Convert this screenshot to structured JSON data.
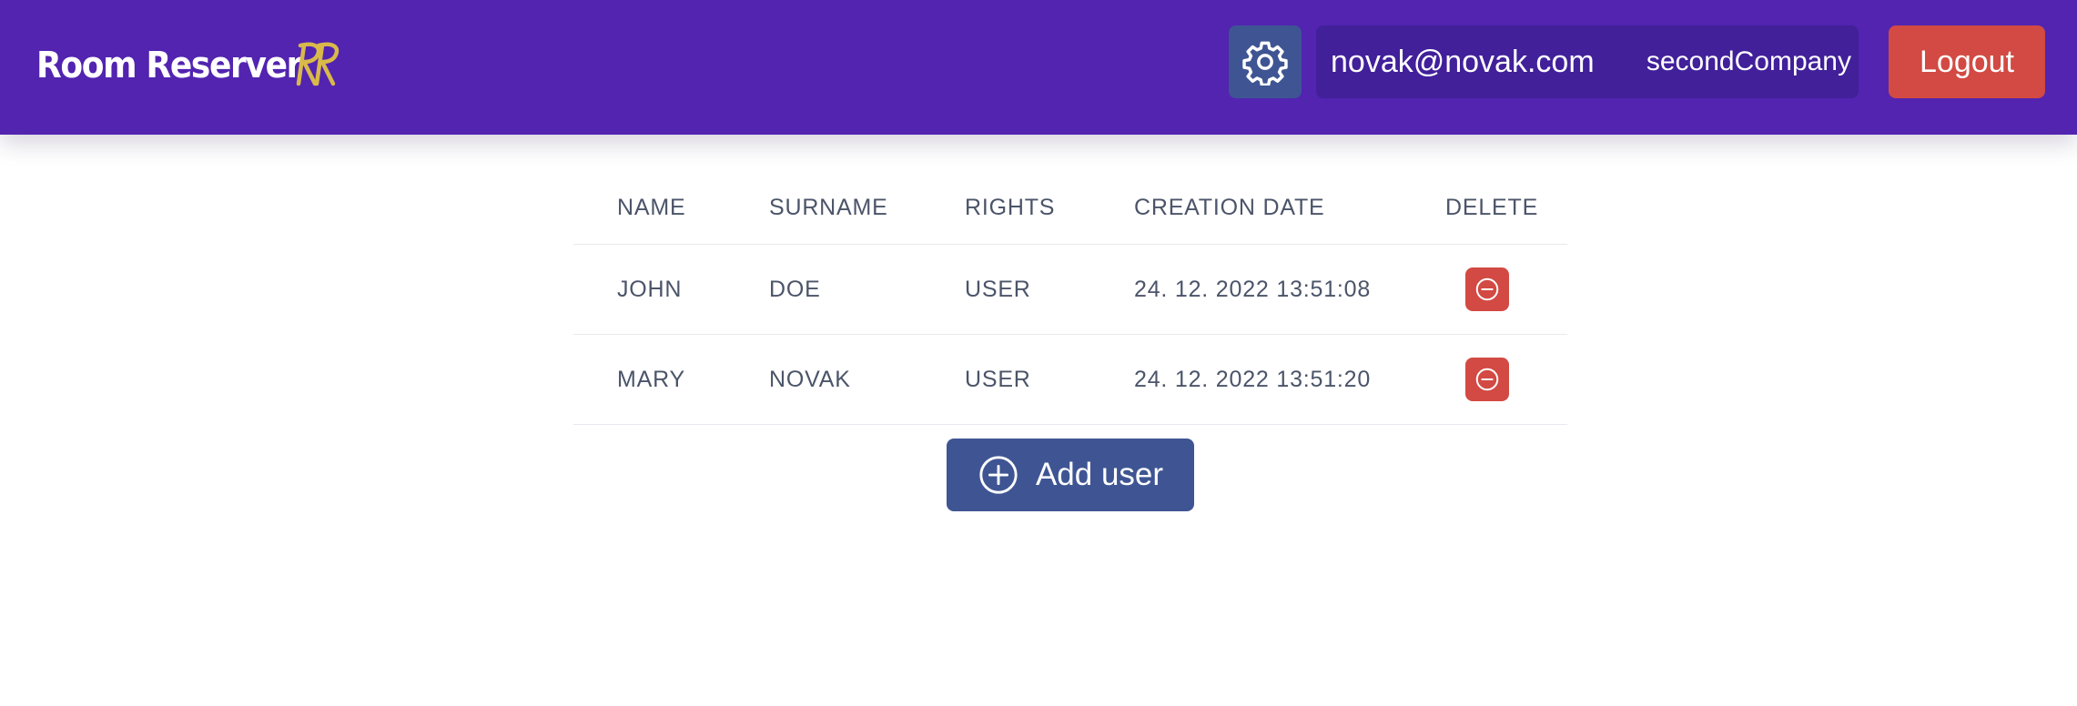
{
  "header": {
    "brand_name": "Room Reserver",
    "settings_icon": "gear-icon",
    "user_email": "novak@novak.com",
    "company": "secondCompany",
    "logout_label": "Logout"
  },
  "table": {
    "columns": [
      "NAME",
      "SURNAME",
      "RIGHTS",
      "CREATION DATE",
      "DELETE"
    ],
    "rows": [
      {
        "name": "JOHN",
        "surname": "DOE",
        "rights": "USER",
        "created": "24. 12. 2022 13:51:08"
      },
      {
        "name": "MARY",
        "surname": "NOVAK",
        "rights": "USER",
        "created": "24. 12. 2022 13:51:20"
      }
    ],
    "delete_icon": "minus-circle-icon"
  },
  "add_user": {
    "label": "Add user",
    "icon": "plus-circle-icon"
  },
  "colors": {
    "header_bg": "#5224b0",
    "user_box_bg": "#41209a",
    "primary_button": "#3f5593",
    "danger_button": "#d24a43",
    "logo_gold": "#d9b94a",
    "table_text": "#4b5469"
  }
}
